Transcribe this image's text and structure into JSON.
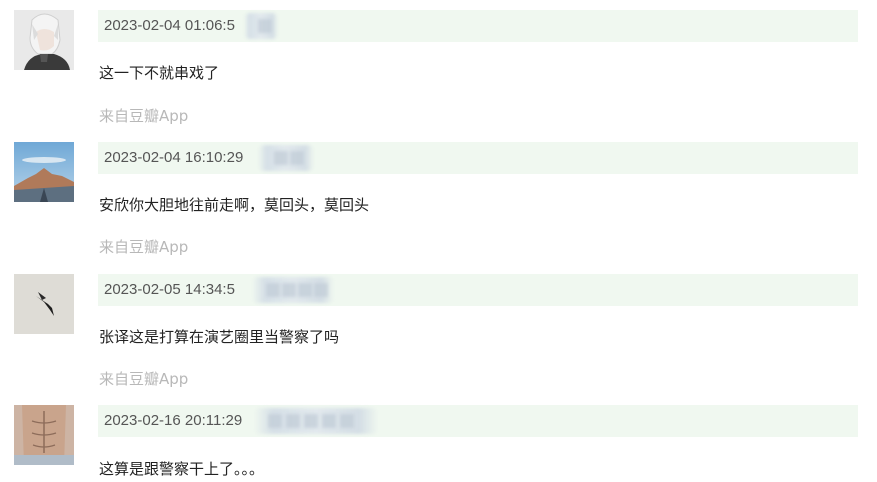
{
  "comments": [
    {
      "timestamp": "2023-02-04 01:06:5",
      "text": "这一下不就串戏了",
      "source": "来自豆瓣App",
      "avatar_icon": "anime-white-hair-avatar-icon"
    },
    {
      "timestamp": "2023-02-04 16:10:29",
      "text": "安欣你大胆地往前走啊，莫回头，莫回头",
      "source": "来自豆瓣App",
      "avatar_icon": "mountain-road-avatar-icon"
    },
    {
      "timestamp": "2023-02-05 14:34:5",
      "text": "张译这是打算在演艺圈里当警察了吗",
      "source": "来自豆瓣App",
      "avatar_icon": "bird-sketch-avatar-icon"
    },
    {
      "timestamp": "2023-02-16 20:11:29",
      "text": "这算是跟警察干上了。。。",
      "source": "",
      "avatar_icon": "abs-torso-avatar-icon"
    }
  ],
  "colors": {
    "meta_bar_bg": "#f0f8f0",
    "timestamp": "#555555",
    "source": "#b8b8b8",
    "text": "#222222"
  }
}
